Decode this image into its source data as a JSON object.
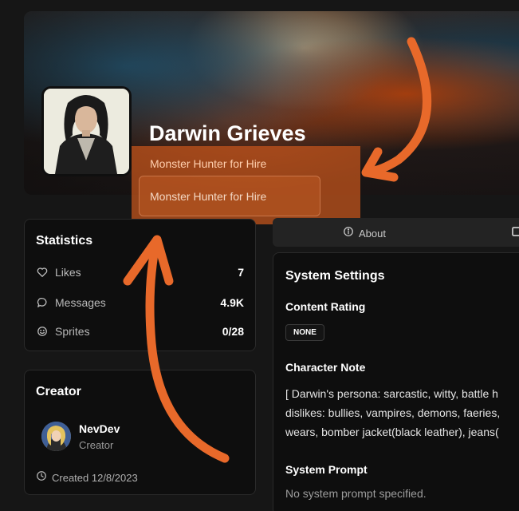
{
  "character": {
    "name": "Darwin Grieves",
    "tagline": "Monster Hunter for Hire",
    "tagline_input": "Monster Hunter for Hire"
  },
  "statistics": {
    "title": "Statistics",
    "items": [
      {
        "icon": "heart-icon",
        "label": "Likes",
        "value": "7"
      },
      {
        "icon": "message-icon",
        "label": "Messages",
        "value": "4.9K"
      },
      {
        "icon": "smiley-icon",
        "label": "Sprites",
        "value": "0/28"
      }
    ]
  },
  "creator": {
    "title": "Creator",
    "name": "NevDev",
    "role": "Creator",
    "created": "Created 12/8/2023"
  },
  "tabs": {
    "about_label": "About"
  },
  "settings": {
    "title": "System Settings",
    "content_rating_label": "Content Rating",
    "content_rating_value": "NONE",
    "character_note_label": "Character Note",
    "character_note_lines": [
      "[ Darwin's persona: sarcastic, witty, battle h",
      "dislikes: bullies, vampires, demons, faeries,",
      "wears, bomber jacket(black leather), jeans("
    ],
    "system_prompt_label": "System Prompt",
    "system_prompt_value": "No system prompt specified."
  },
  "colors": {
    "background": "#161616",
    "card": "#0e0e0e",
    "annotation_orange": "#e8692a"
  }
}
